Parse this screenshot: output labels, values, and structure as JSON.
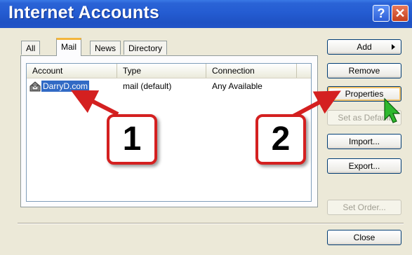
{
  "window": {
    "title": "Internet Accounts",
    "help_glyph": "?",
    "close_glyph": "✕"
  },
  "tabs": [
    {
      "label": "All"
    },
    {
      "label": "Mail",
      "selected": true
    },
    {
      "label": "News"
    },
    {
      "label": "Directory Service"
    }
  ],
  "list": {
    "columns": [
      "Account",
      "Type",
      "Connection"
    ],
    "rows": [
      {
        "account": "DarryD.com",
        "type": "mail (default)",
        "connection": "Any Available",
        "selected": true,
        "icon": "mail-account-icon"
      }
    ]
  },
  "buttons": {
    "add": "Add",
    "remove": "Remove",
    "properties": "Properties",
    "set_default": "Set as Default",
    "import": "Import...",
    "export": "Export...",
    "set_order": "Set Order...",
    "close": "Close"
  },
  "annotations": [
    {
      "number": "1",
      "points_to": "account-name"
    },
    {
      "number": "2",
      "points_to": "properties-button"
    }
  ],
  "colors": {
    "title_bar": "#245cd2",
    "selection": "#316ac5",
    "annotation": "#d42020",
    "cursor": "#2eb82e"
  }
}
